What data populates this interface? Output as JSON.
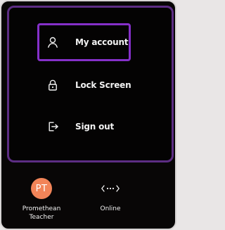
{
  "menu": {
    "items": [
      {
        "label": "My account",
        "icon": "person-icon",
        "selected": true
      },
      {
        "label": "Lock Screen",
        "icon": "lock-icon",
        "selected": false
      },
      {
        "label": "Sign out",
        "icon": "sign-out-icon",
        "selected": false
      }
    ]
  },
  "footer": {
    "profile": {
      "initials": "PT",
      "name": "Promethean Teacher",
      "avatar_color": "#F28458"
    },
    "presence": {
      "label": "Online",
      "icon": "presence-icon"
    }
  },
  "colors": {
    "panel_background": "#080606",
    "menu_border": "#5D2D84",
    "selected_border": "#8530C9",
    "text": "#F2F2F2"
  }
}
